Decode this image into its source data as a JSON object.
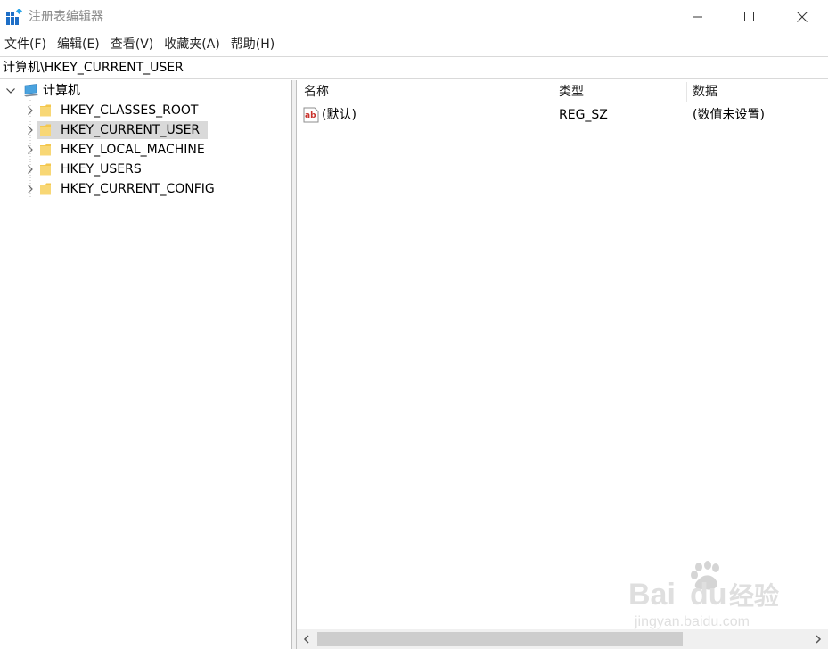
{
  "window": {
    "title": "注册表编辑器"
  },
  "menu": {
    "items": [
      "文件(F)",
      "编辑(E)",
      "查看(V)",
      "收藏夹(A)",
      "帮助(H)"
    ]
  },
  "address": {
    "path": "计算机\\HKEY_CURRENT_USER"
  },
  "tree": {
    "root_label": "计算机",
    "items": [
      {
        "label": "HKEY_CLASSES_ROOT",
        "selected": false
      },
      {
        "label": "HKEY_CURRENT_USER",
        "selected": true
      },
      {
        "label": "HKEY_LOCAL_MACHINE",
        "selected": false
      },
      {
        "label": "HKEY_USERS",
        "selected": false
      },
      {
        "label": "HKEY_CURRENT_CONFIG",
        "selected": false
      }
    ]
  },
  "list": {
    "columns": [
      "名称",
      "类型",
      "数据"
    ],
    "rows": [
      {
        "name": "(默认)",
        "type": "REG_SZ",
        "data": "(数值未设置)"
      }
    ]
  },
  "watermark": {
    "brand": "Bai",
    "brand2": "du",
    "brand_cn": "经验",
    "url": "jingyan.baidu.com"
  },
  "colors": {
    "selected_bg": "#d9d9d9",
    "folder": "#f3c74e",
    "accent": "#0078d7"
  }
}
